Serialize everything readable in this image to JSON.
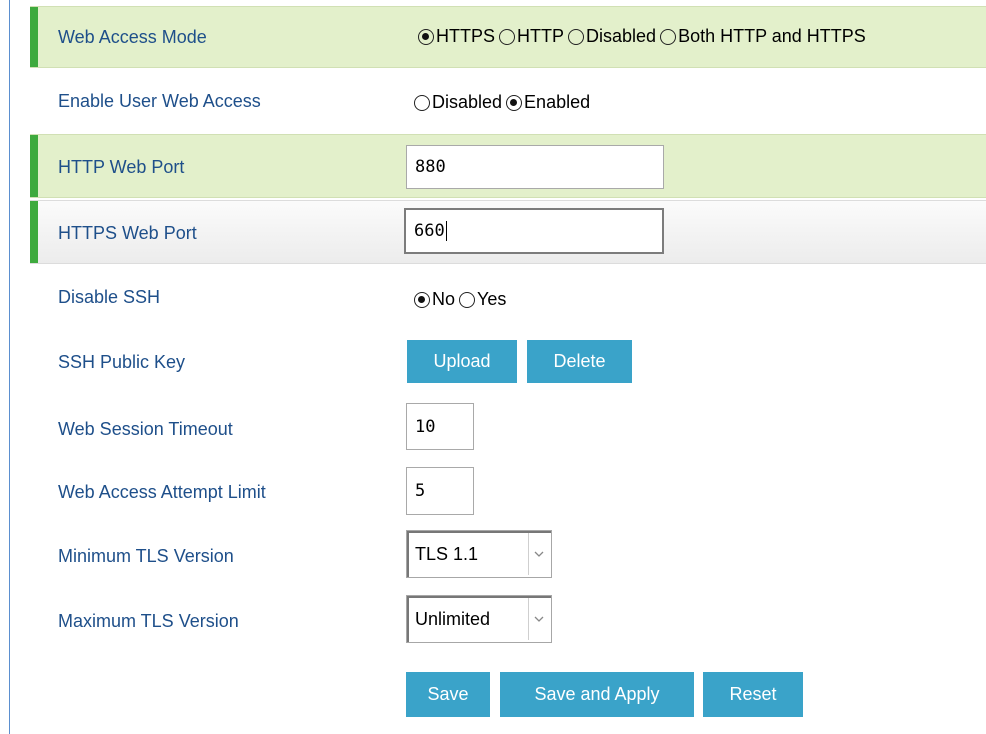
{
  "web_access_mode": {
    "label": "Web Access Mode",
    "options": [
      "HTTPS",
      "HTTP",
      "Disabled",
      "Both HTTP and HTTPS"
    ],
    "selected": "HTTPS"
  },
  "enable_user_web_access": {
    "label": "Enable User Web Access",
    "options": [
      "Disabled",
      "Enabled"
    ],
    "selected": "Enabled"
  },
  "http_web_port": {
    "label": "HTTP Web Port",
    "value": "880"
  },
  "https_web_port": {
    "label": "HTTPS Web Port",
    "value": "660"
  },
  "disable_ssh": {
    "label": "Disable SSH",
    "options": [
      "No",
      "Yes"
    ],
    "selected": "No"
  },
  "ssh_public_key": {
    "label": "SSH Public Key",
    "upload_label": "Upload",
    "delete_label": "Delete"
  },
  "web_session_timeout": {
    "label": "Web Session Timeout",
    "value": "10"
  },
  "web_access_attempt_limit": {
    "label": "Web Access Attempt Limit",
    "value": "5"
  },
  "min_tls": {
    "label": "Minimum TLS Version",
    "value": "TLS 1.1"
  },
  "max_tls": {
    "label": "Maximum TLS Version",
    "value": "Unlimited"
  },
  "actions": {
    "save": "Save",
    "save_apply": "Save and Apply",
    "reset": "Reset"
  },
  "colors": {
    "label_text": "#1e4f8a",
    "highlight_row": "#e3f0cb",
    "accent_bar": "#3eaa3e",
    "button": "#3aa3c9"
  }
}
